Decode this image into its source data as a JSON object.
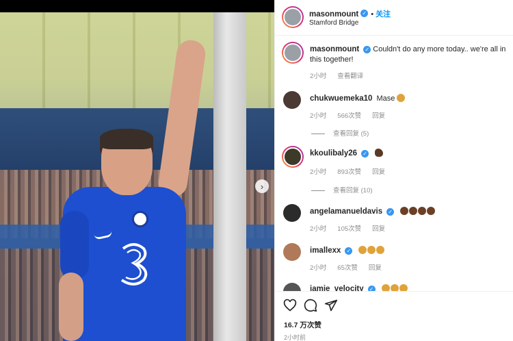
{
  "post": {
    "author": "masonmount",
    "follow_label": "关注",
    "separator": "•",
    "location": "Stamford Bridge",
    "caption": "Couldn't do any more today.. we're all in this together!",
    "caption_time": "2小时",
    "translate_label": "查看翻译",
    "likes": "16.7 万次赞",
    "posted_time": "2小时前"
  },
  "comments": [
    {
      "user": "chukwuemeka10",
      "verified": false,
      "text": "Mase",
      "time": "2小时",
      "likes": "566次赞",
      "reply_label": "回复",
      "view_replies": "查看回复 (5)",
      "emoji_color": "#e0a33a"
    },
    {
      "user": "kkoulibaly26",
      "verified": true,
      "text": "",
      "time": "2小时",
      "likes": "893次赞",
      "reply_label": "回复",
      "view_replies": "查看回复 (10)",
      "emoji_color": "#5a3a24"
    },
    {
      "user": "angelamanueldavis",
      "verified": true,
      "text": "",
      "time": "2小时",
      "likes": "105次赞",
      "reply_label": "回复",
      "view_replies": "",
      "emoji_color": "#6b4026"
    },
    {
      "user": "imallexx",
      "verified": true,
      "text": "",
      "time": "2小时",
      "likes": "65次赞",
      "reply_label": "回复",
      "view_replies": "",
      "emoji_color": "#e0a33a"
    },
    {
      "user": "jamie_velocity",
      "verified": true,
      "text": "",
      "time": "",
      "likes": "",
      "reply_label": "",
      "view_replies": "",
      "emoji_color": "#e0a33a"
    }
  ],
  "icons": {
    "verified": "verified-badge",
    "like": "heart-icon",
    "comment": "comment-icon",
    "share": "share-icon",
    "next": "chevron-right-icon"
  },
  "colors": {
    "accent": "#0095f6",
    "verified": "#3897f0",
    "muted": "#8e8e8e"
  }
}
